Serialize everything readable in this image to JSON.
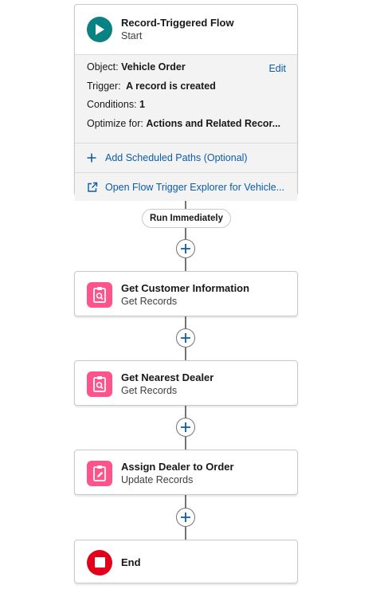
{
  "start": {
    "title": "Record-Triggered Flow",
    "subtitle": "Start",
    "edit_label": "Edit",
    "object_label": "Object:",
    "object_value": "Vehicle Order",
    "trigger_label": "Trigger:",
    "trigger_value": "A record is created",
    "conditions_label": "Conditions:",
    "conditions_value": "1",
    "optimize_label": "Optimize for:",
    "optimize_value": "Actions and Related Recor...",
    "scheduled_paths_label": "Add Scheduled Paths (Optional)",
    "explorer_label": "Open Flow Trigger Explorer for Vehicle..."
  },
  "path_label": "Run Immediately",
  "elements": [
    {
      "title": "Get Customer Information",
      "subtitle": "Get Records",
      "icon": "get-records-icon"
    },
    {
      "title": "Get Nearest Dealer",
      "subtitle": "Get Records",
      "icon": "get-records-icon"
    },
    {
      "title": "Assign Dealer to Order",
      "subtitle": "Update Records",
      "icon": "update-records-icon"
    }
  ],
  "end": {
    "title": "End"
  },
  "colors": {
    "start_icon": "#088282",
    "record_tile": "#ff538a",
    "end_icon": "#e3001a",
    "link": "#0b5cab",
    "connector": "#747474"
  }
}
